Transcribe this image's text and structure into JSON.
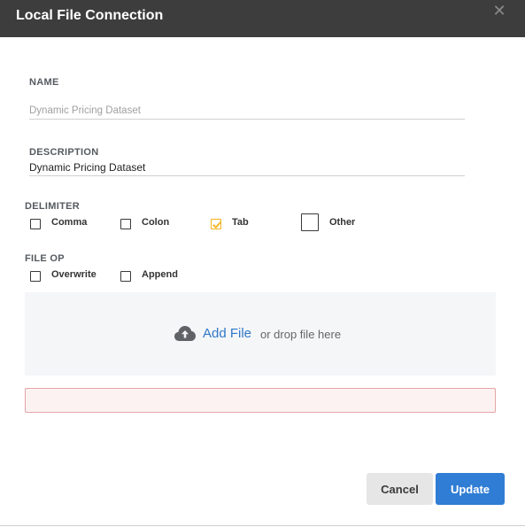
{
  "dialog": {
    "title": "Local File Connection",
    "close_icon": "close-icon"
  },
  "form": {
    "name": {
      "label": "NAME",
      "value": "",
      "placeholder": "Dynamic Pricing Dataset"
    },
    "description": {
      "label": "DESCRIPTION",
      "value": "Dynamic Pricing Dataset"
    },
    "delimiter": {
      "label": "DELIMITER",
      "options": [
        {
          "label": "Comma",
          "checked": false
        },
        {
          "label": "Colon",
          "checked": false
        },
        {
          "label": "Tab",
          "checked": true
        },
        {
          "label": "Other",
          "checked": false
        }
      ]
    },
    "file_op": {
      "label": "FILE OP",
      "options": [
        {
          "label": "Overwrite",
          "checked": false
        },
        {
          "label": "Append",
          "checked": false
        }
      ]
    }
  },
  "upload": {
    "icon": "cloud-upload-icon",
    "add_file_label": "Add File",
    "drop_text": "or drop file here"
  },
  "buttons": {
    "cancel_label": "Cancel",
    "update_label": "Update"
  },
  "colors": {
    "titlebar": "#3d3d3d",
    "accent_blue": "#2f7dd4",
    "checked_yellow": "#f3b21b",
    "error_border": "#e3a4a4"
  }
}
